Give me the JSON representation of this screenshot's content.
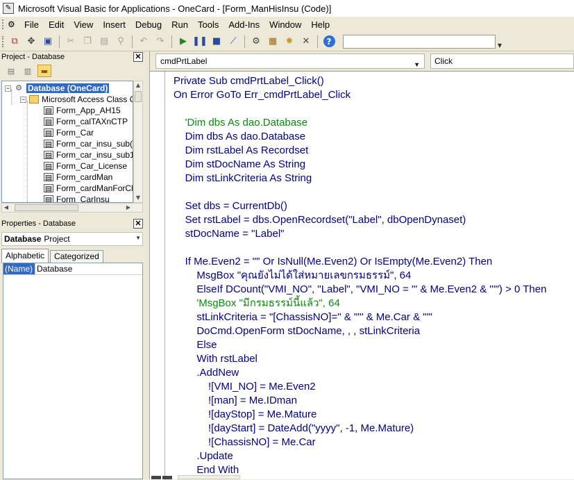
{
  "window": {
    "title": "Microsoft Visual Basic for Applications - OneCard - [Form_ManHisInsu (Code)]"
  },
  "menu": [
    "File",
    "Edit",
    "View",
    "Insert",
    "Debug",
    "Run",
    "Tools",
    "Add-Ins",
    "Window",
    "Help"
  ],
  "toolbar": {
    "icons": [
      "access-view-icon",
      "insert-module-icon",
      "save-icon",
      "cut-icon",
      "copy-icon",
      "paste-icon",
      "find-icon",
      "undo-icon",
      "redo-icon",
      "run-icon",
      "break-icon",
      "reset-icon",
      "design-mode-icon",
      "project-explorer-icon",
      "properties-window-icon",
      "object-browser-icon",
      "toolbox-icon",
      "help-icon"
    ]
  },
  "project_pane": {
    "title": "Project - Database",
    "tree": [
      {
        "label": "Database (OneCard)",
        "level": 0,
        "type": "database",
        "selected": true
      },
      {
        "label": "Microsoft Access Class O",
        "level": 1,
        "type": "folder"
      },
      {
        "label": "Form_App_AH15",
        "level": 2,
        "type": "form"
      },
      {
        "label": "Form_calTAXnCTP",
        "level": 2,
        "type": "form"
      },
      {
        "label": "Form_Car",
        "level": 2,
        "type": "form"
      },
      {
        "label": "Form_car_insu_sub(",
        "level": 2,
        "type": "form"
      },
      {
        "label": "Form_car_insu_sub1",
        "level": 2,
        "type": "form"
      },
      {
        "label": "Form_Car_License",
        "level": 2,
        "type": "form"
      },
      {
        "label": "Form_cardMan",
        "level": 2,
        "type": "form"
      },
      {
        "label": "Form_cardManForCh",
        "level": 2,
        "type": "form"
      },
      {
        "label": "Form_CarInsu",
        "level": 2,
        "type": "form"
      }
    ]
  },
  "properties_pane": {
    "title": "Properties - Database",
    "object_name": "Database",
    "object_type": "Project",
    "tabs": [
      "Alphabetic",
      "Categorized"
    ],
    "rows": [
      {
        "name": "(Name)",
        "value": "Database"
      }
    ]
  },
  "code_window": {
    "object": "cmdPrtLabel",
    "procedure": "Click",
    "lines": [
      {
        "text": "Private Sub cmdPrtLabel_Click()",
        "kind": "code"
      },
      {
        "text": "On Error GoTo Err_cmdPrtLabel_Click",
        "kind": "code"
      },
      {
        "text": "",
        "kind": "code"
      },
      {
        "text": "    'Dim dbs As dao.Database",
        "kind": "comment"
      },
      {
        "text": "    Dim dbs As dao.Database",
        "kind": "code"
      },
      {
        "text": "    Dim rstLabel As Recordset",
        "kind": "code"
      },
      {
        "text": "    Dim stDocName As String",
        "kind": "code"
      },
      {
        "text": "    Dim stLinkCriteria As String",
        "kind": "code"
      },
      {
        "text": "",
        "kind": "code"
      },
      {
        "text": "    Set dbs = CurrentDb()",
        "kind": "code"
      },
      {
        "text": "    Set rstLabel = dbs.OpenRecordset(\"Label\", dbOpenDynaset)",
        "kind": "code"
      },
      {
        "text": "    stDocName = \"Label\"",
        "kind": "code"
      },
      {
        "text": "",
        "kind": "code"
      },
      {
        "text": "    If Me.Even2 = \"\" Or IsNull(Me.Even2) Or IsEmpty(Me.Even2) Then",
        "kind": "code"
      },
      {
        "text": "        MsgBox \"คุณยังไม่ได้ใส่หมายเลขกรมธรรม์\", 64",
        "kind": "code"
      },
      {
        "text": "        ElseIf DCount(\"VMI_NO\", \"Label\", \"VMI_NO = '\" & Me.Even2 & \"'\") > 0 Then",
        "kind": "code"
      },
      {
        "text": "        'MsgBox \"มีกรมธรรม์นี้แล้ว\", 64",
        "kind": "comment"
      },
      {
        "text": "        stLinkCriteria = \"[ChassisNO]=\" & \"'\" & Me.Car & \"'\"",
        "kind": "code"
      },
      {
        "text": "        DoCmd.OpenForm stDocName, , , stLinkCriteria",
        "kind": "code"
      },
      {
        "text": "        Else",
        "kind": "code"
      },
      {
        "text": "        With rstLabel",
        "kind": "code"
      },
      {
        "text": "        .AddNew",
        "kind": "code"
      },
      {
        "text": "            ![VMI_NO] = Me.Even2",
        "kind": "code"
      },
      {
        "text": "            ![man] = Me.IDman",
        "kind": "code"
      },
      {
        "text": "            ![dayStop] = Me.Mature",
        "kind": "code"
      },
      {
        "text": "            ![dayStart] = DateAdd(\"yyyy\", -1, Me.Mature)",
        "kind": "code"
      },
      {
        "text": "            ![ChassisNO] = Me.Car",
        "kind": "code"
      },
      {
        "text": "        .Update",
        "kind": "code"
      },
      {
        "text": "        End With",
        "kind": "code"
      }
    ]
  }
}
